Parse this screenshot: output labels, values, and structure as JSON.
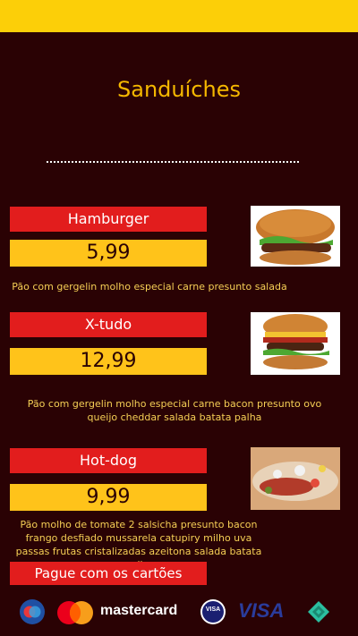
{
  "page": {
    "title": "Sanduíches"
  },
  "items": [
    {
      "name": "Hamburger",
      "price": "5,99",
      "description": "Pão com gergelin molho especial carne presunto salada"
    },
    {
      "name": "X-tudo",
      "price": "12,99",
      "description": "Pão com gergelin molho especial carne bacon presunto ovo queijo cheddar salada batata palha"
    },
    {
      "name": "Hot-dog",
      "price": "9,99",
      "description": "Pão  molho de tomate  2 salsicha presunto bacon frango desfiado mussarela catupiry milho uva passas frutas cristalizadas azeitona salada batata palha"
    }
  ],
  "payment": {
    "label": "Pague com os cartões",
    "mastercard_text": "mastercard",
    "visa_badge_text": "VISA",
    "visa_text": "VISA"
  },
  "colors": {
    "background": "#2a0204",
    "topbar": "#fccf08",
    "title": "#f5b800",
    "red": "#e21d1d",
    "yellow": "#ffc31a"
  },
  "icons": [
    "maestro-icon",
    "mastercard-logo-icon",
    "visa-badge-icon",
    "visa-logo-icon",
    "diamond-logo-icon"
  ]
}
